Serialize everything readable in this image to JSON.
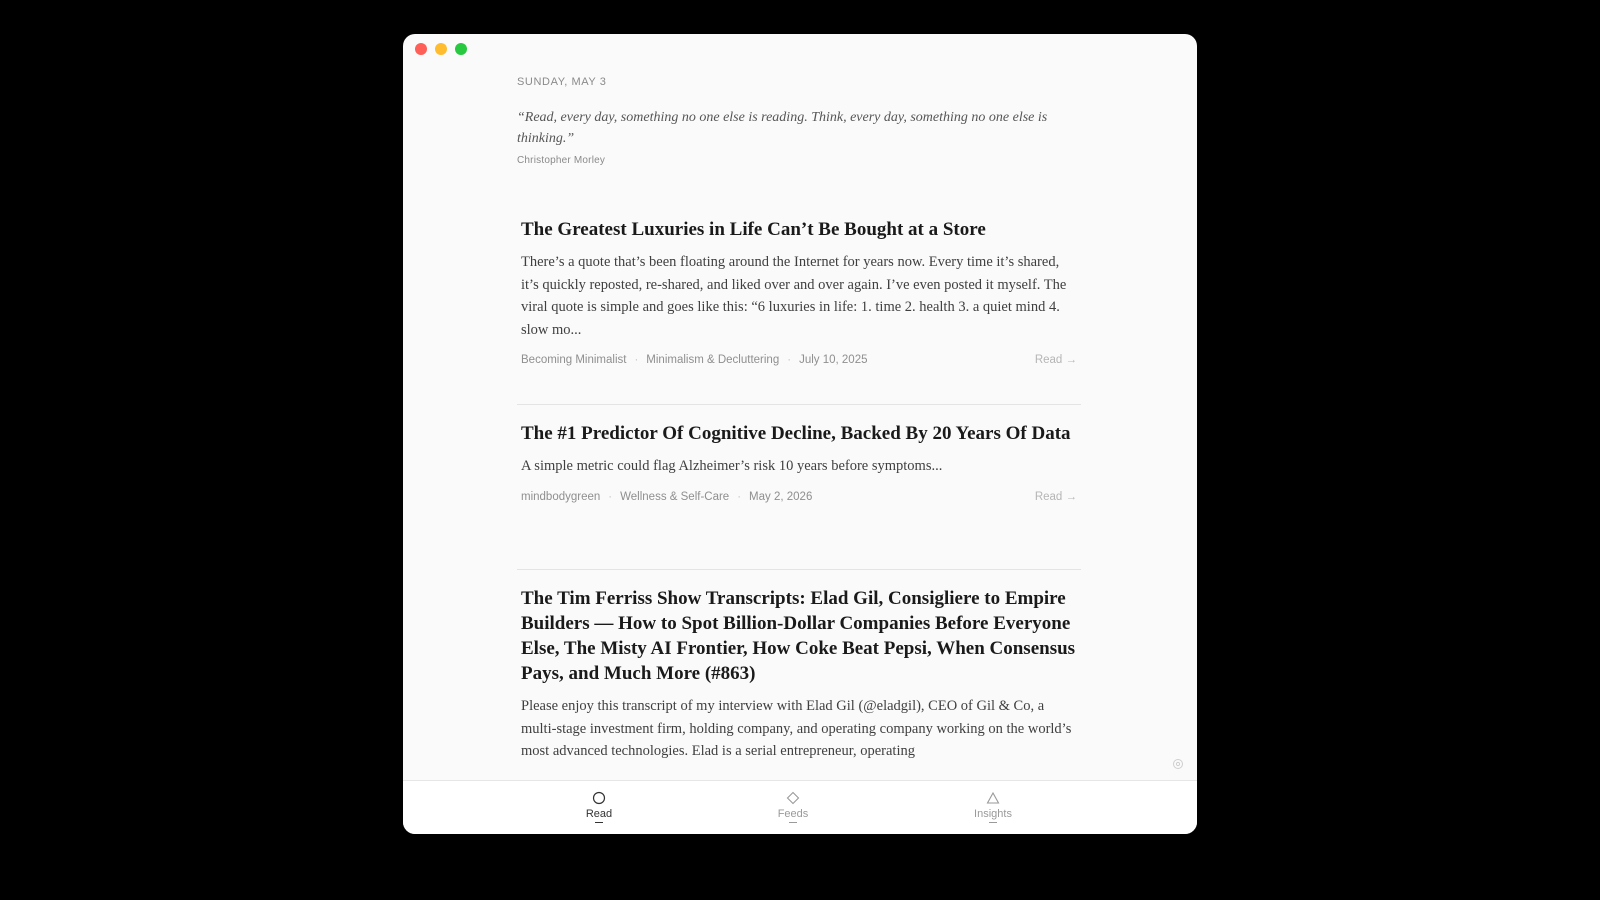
{
  "colors": {
    "background": "#000000",
    "window": "#fafafa",
    "traffic_red": "#fe5f57",
    "traffic_yellow": "#febc2e",
    "traffic_green": "#28c840",
    "title_text": "#1a1a1a",
    "body_text": "#3f3f3f",
    "meta_text": "#8f8f8f"
  },
  "header": {
    "date": "SUNDAY, MAY 3",
    "quote": "“Read, every day, something no one else is reading. Think, every day, something no one else is thinking.”",
    "quote_author": "Christopher Morley"
  },
  "articles": [
    {
      "title": "The Greatest Luxuries in Life Can’t Be Bought at a Store",
      "excerpt": "There’s a quote that’s been floating around the Internet for years now. Every time it’s shared, it’s quickly reposted, re-shared, and liked over and over again. I’ve even posted it myself. The viral quote is simple and goes like this: “6 luxuries in life: 1. time 2. health 3. a quiet mind 4. slow mo...",
      "source": "Becoming Minimalist",
      "category": "Minimalism & Decluttering",
      "date": "July 10, 2025",
      "action": "Read →"
    },
    {
      "title": "The #1 Predictor Of Cognitive Decline, Backed By 20 Years Of Data",
      "excerpt": "A simple metric could flag Alzheimer’s risk 10 years before symptoms...",
      "source": "mindbodygreen",
      "category": "Wellness & Self-Care",
      "date": "May 2, 2026",
      "action": "Read →"
    },
    {
      "title": "The Tim Ferriss Show Transcripts: Elad Gil, Consigliere to Empire Builders — How to Spot Billion-Dollar Companies Before Everyone Else, The Misty AI Frontier, How Coke Beat Pepsi, When Consensus Pays, and Much More (#863)",
      "excerpt": "Please enjoy this transcript of my interview with Elad Gil (@eladgil), CEO of Gil & Co, a multi-stage investment firm, holding company, and operating company working on the world’s most advanced technologies. Elad is a serial entrepreneur, operating"
    }
  ],
  "tabs": [
    {
      "label": "Read",
      "icon": "circle-icon",
      "active": true
    },
    {
      "label": "Feeds",
      "icon": "diamond-icon",
      "active": false
    },
    {
      "label": "Insights",
      "icon": "triangle-icon",
      "active": false
    }
  ],
  "icons": {
    "settings": "gear-icon"
  }
}
